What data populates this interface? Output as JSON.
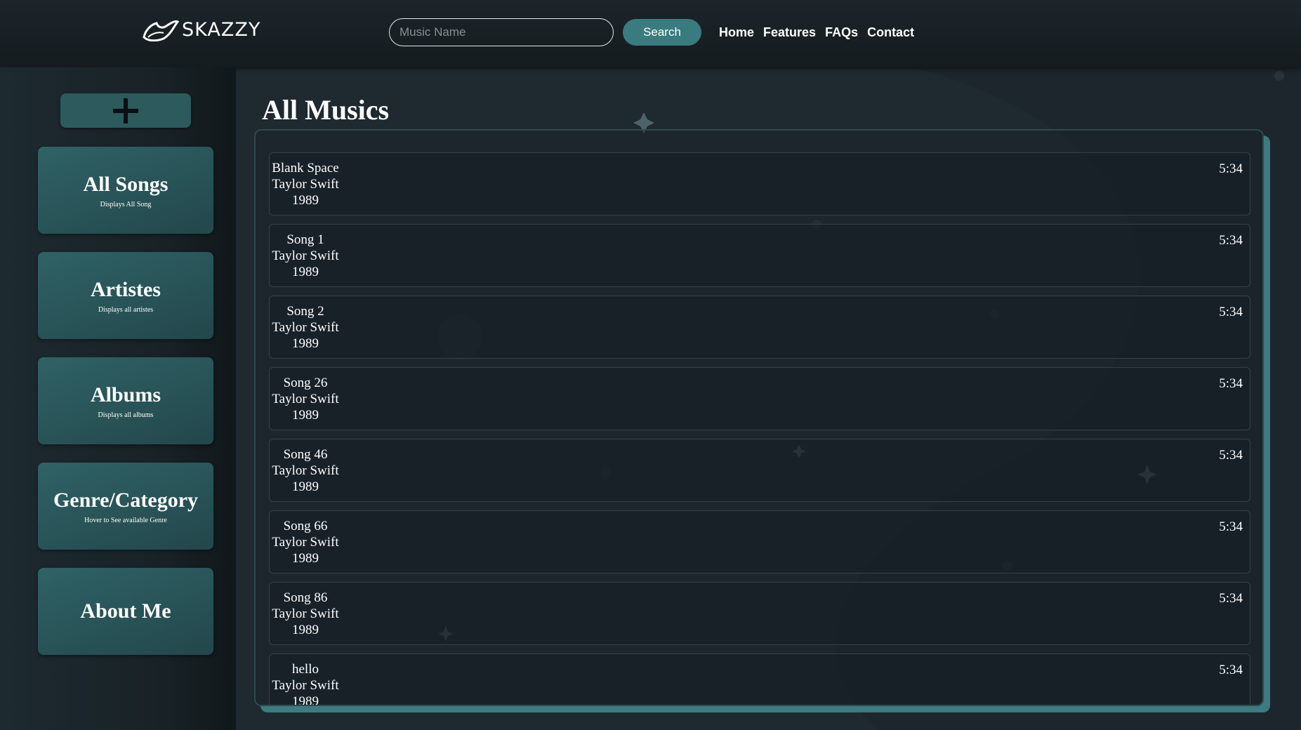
{
  "header": {
    "logo_text": "SKAZZY",
    "search_placeholder": "Music Name",
    "search_label": "Search",
    "nav": [
      "Home",
      "Features",
      "FAQs",
      "Contact"
    ]
  },
  "sidebar": {
    "add_icon": "plus-icon",
    "cards": [
      {
        "title": "All Songs",
        "subtitle": "Displays All Song"
      },
      {
        "title": "Artistes",
        "subtitle": "Displays all artistes"
      },
      {
        "title": "Albums",
        "subtitle": "Displays all albums"
      },
      {
        "title": "Genre/Category",
        "subtitle": "Hover to See available Genre"
      },
      {
        "title": "About Me",
        "subtitle": ""
      }
    ]
  },
  "main": {
    "title": "All Musics",
    "songs": [
      {
        "name": "Blank Space",
        "artist": "Taylor Swift",
        "album": "1989",
        "duration": "5:34"
      },
      {
        "name": "Song 1",
        "artist": "Taylor Swift",
        "album": "1989",
        "duration": "5:34"
      },
      {
        "name": "Song 2",
        "artist": "Taylor Swift",
        "album": "1989",
        "duration": "5:34"
      },
      {
        "name": "Song 26",
        "artist": "Taylor Swift",
        "album": "1989",
        "duration": "5:34"
      },
      {
        "name": "Song 46",
        "artist": "Taylor Swift",
        "album": "1989",
        "duration": "5:34"
      },
      {
        "name": "Song 66",
        "artist": "Taylor Swift",
        "album": "1989",
        "duration": "5:34"
      },
      {
        "name": "Song 86",
        "artist": "Taylor Swift",
        "album": "1989",
        "duration": "5:34"
      },
      {
        "name": "hello",
        "artist": "Taylor Swift",
        "album": "1989",
        "duration": "5:34"
      }
    ]
  },
  "colors": {
    "accent": "#3a7b7f",
    "card": "#2c5a5d",
    "background": "#1f2930"
  }
}
